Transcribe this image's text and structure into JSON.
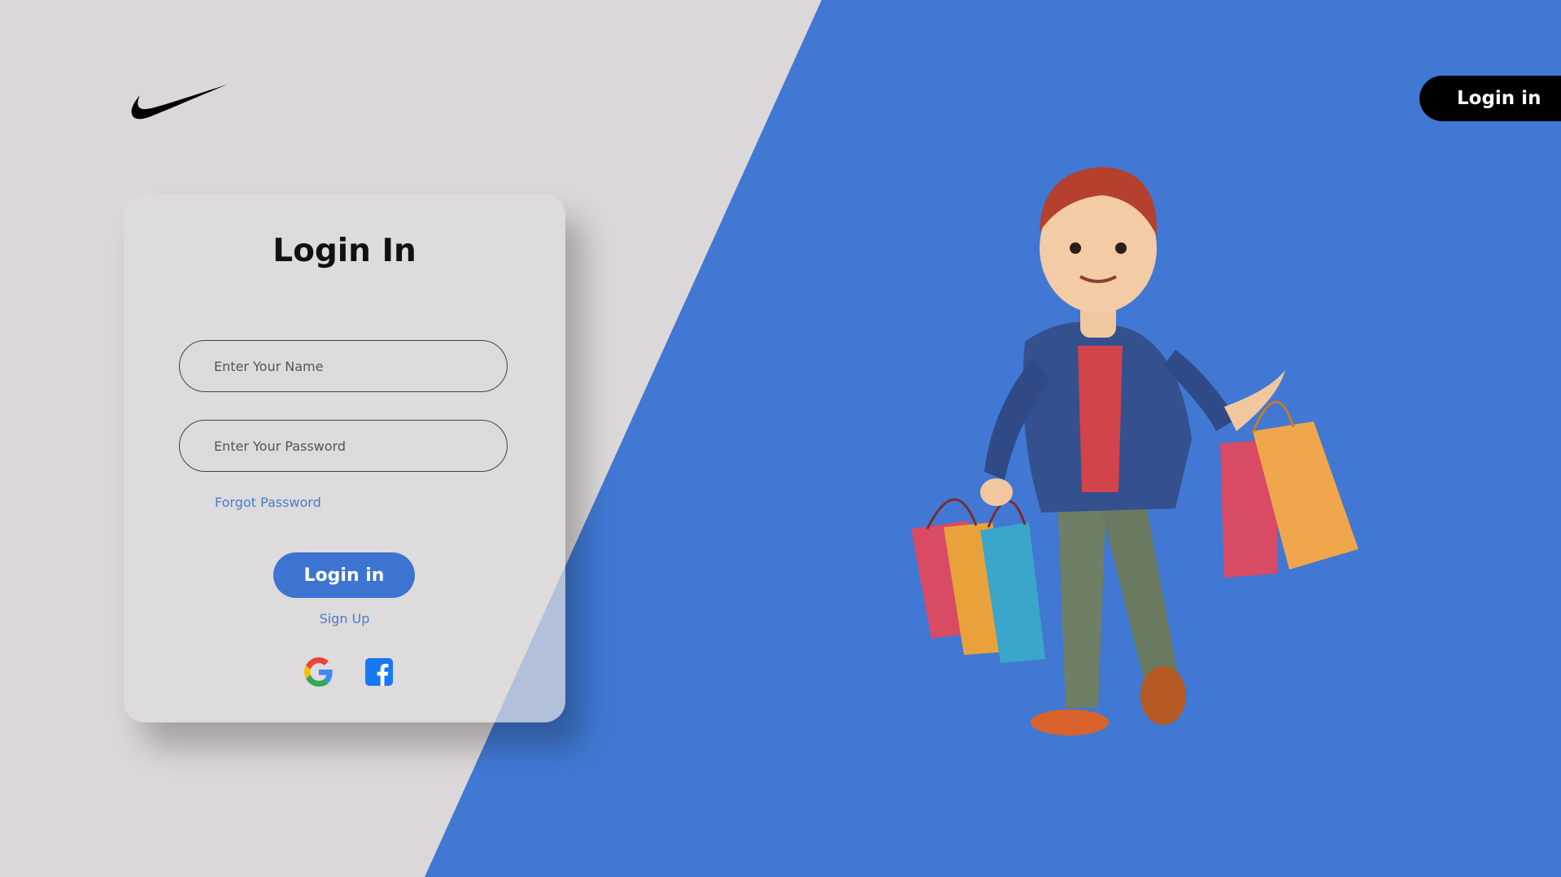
{
  "header": {
    "logo_icon": "swoosh-logo",
    "login_button_label": "Login in"
  },
  "login_card": {
    "title": "Login In",
    "name_placeholder": "Enter Your Name",
    "password_placeholder": "Enter Your Password",
    "forgot_password_label": "Forgot Password",
    "login_button_label": "Login in",
    "signup_label": "Sign Up",
    "social_icons": [
      "google-icon",
      "facebook-icon"
    ]
  },
  "hero": {
    "illustration": "shopper-with-bags-illustration"
  },
  "colors": {
    "background_left": "#dcd8d9",
    "background_right": "#4178d3",
    "primary_button": "#3d74d1",
    "link": "#4a7ccc",
    "dark_button": "#000000"
  }
}
